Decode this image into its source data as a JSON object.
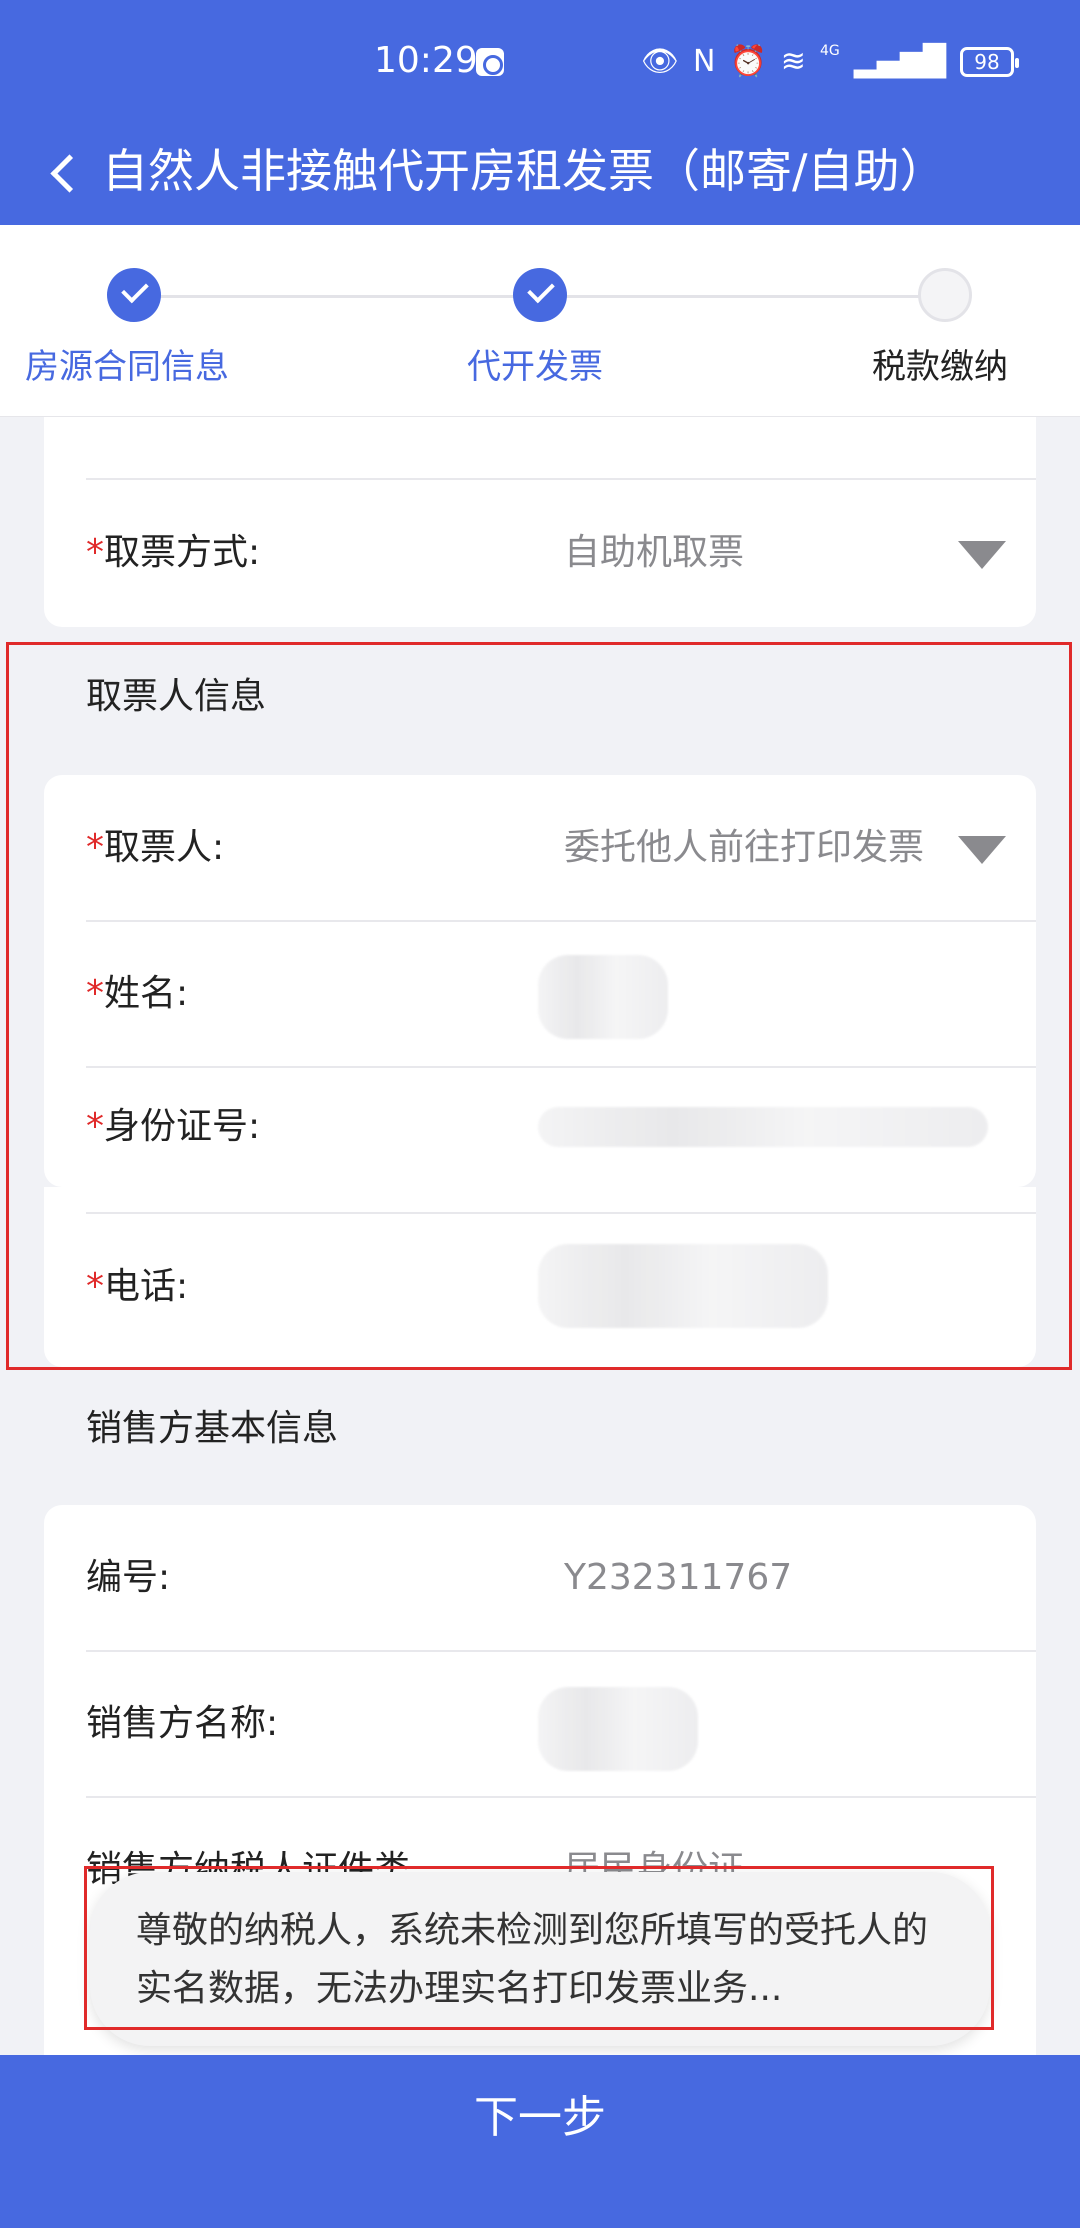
{
  "status_bar": {
    "time": "10:29",
    "battery": "98",
    "network": "4G",
    "icons": [
      "eye-icon",
      "nfc-icon",
      "alarm-icon",
      "wifi-icon",
      "signal-icon",
      "battery-icon"
    ]
  },
  "nav": {
    "back_icon": "chevron-left-icon",
    "title": "自然人非接触代开房租发票（邮寄/自助）"
  },
  "stepper": {
    "steps": [
      {
        "label": "房源合同信息",
        "state": "done"
      },
      {
        "label": "代开发票",
        "state": "done"
      },
      {
        "label": "税款缴纳",
        "state": "todo"
      }
    ]
  },
  "ticket_method": {
    "required_mark": "*",
    "label": "取票方式:",
    "value": "自助机取票"
  },
  "recipient_section": {
    "title": "取票人信息",
    "rows": [
      {
        "required_mark": "*",
        "label": "取票人:",
        "value": "委托他人前往打印发票"
      },
      {
        "required_mark": "*",
        "label": "姓名:",
        "value": ""
      },
      {
        "required_mark": "*",
        "label": "身份证号:",
        "value": ""
      },
      {
        "required_mark": "*",
        "label": "电话:",
        "value": ""
      }
    ]
  },
  "seller_section": {
    "title": "销售方基本信息",
    "rows": [
      {
        "label": "编号:",
        "value": "Y232311767"
      },
      {
        "label": "销售方名称:",
        "value": ""
      },
      {
        "label": "销售方纳税人证件类",
        "value": "居民身份证"
      }
    ]
  },
  "toast": {
    "message": "尊敬的纳税人，系统未检测到您所填写的受托人的实名数据，无法办理实名打印发票业务..."
  },
  "footer": {
    "next_label": "下一步"
  },
  "colors": {
    "primary": "#4769e0",
    "required": "#e02a2a",
    "highlight": "#e02a2a",
    "background": "#f1f2f6"
  }
}
